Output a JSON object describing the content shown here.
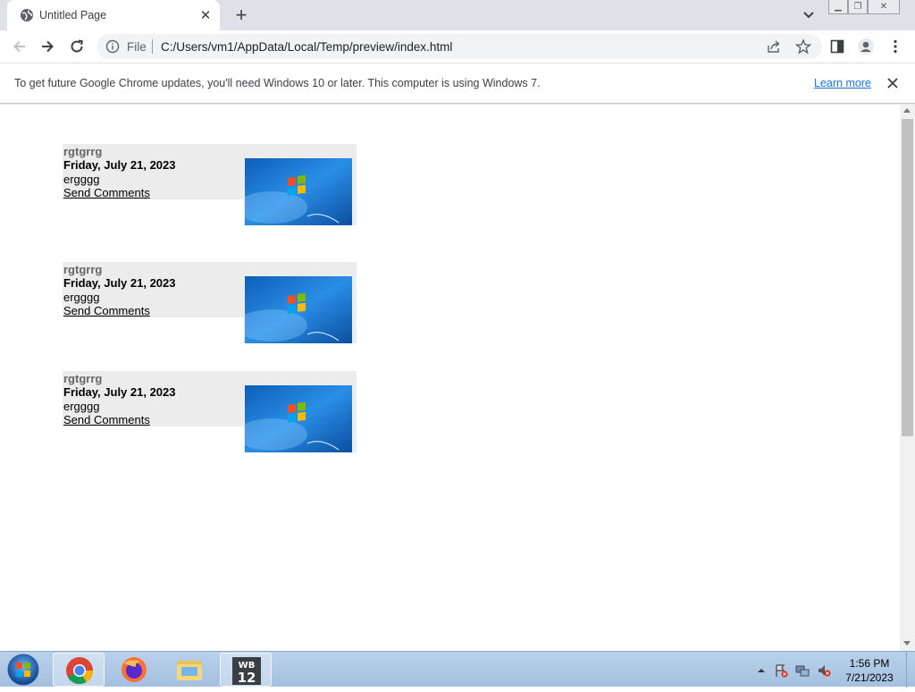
{
  "browser": {
    "tab_title": "Untitled Page",
    "address_scheme": "File",
    "address_url": "C:/Users/vm1/AppData/Local/Temp/preview/index.html"
  },
  "infobar": {
    "message": "To get future Google Chrome updates, you'll need Windows 10 or later. This computer is using Windows 7.",
    "learn_more": "Learn more"
  },
  "entries": [
    {
      "title": "rgtgrrg",
      "date": "Friday, July 21, 2023",
      "body": "ergggg",
      "link": "Send Comments"
    },
    {
      "title": "rgtgrrg",
      "date": "Friday, July 21, 2023",
      "body": "ergggg",
      "link": "Send Comments"
    },
    {
      "title": "rgtgrrg",
      "date": "Friday, July 21, 2023",
      "body": "ergggg",
      "link": "Send Comments"
    }
  ],
  "taskbar": {
    "apps": [
      "chrome-icon",
      "firefox-icon",
      "file-explorer-icon",
      "wb12-icon"
    ],
    "wb_label": "WB 12",
    "clock_time": "1:56 PM",
    "clock_date": "7/21/2023"
  },
  "colors": {
    "accent": "#1a73e8",
    "tab_strip": "#dee1e6",
    "entry_bg": "#ececec",
    "taskbar": "#a4c0e0"
  }
}
